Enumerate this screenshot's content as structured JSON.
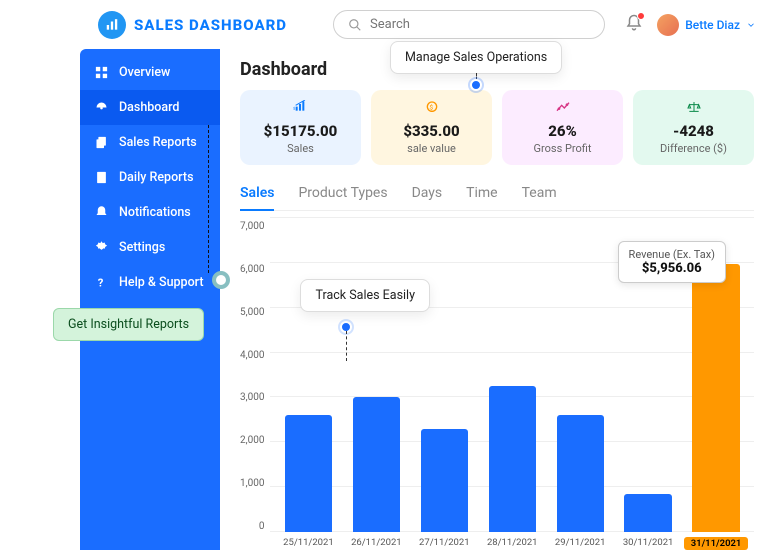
{
  "brand": "SALES  DASHBOARD",
  "search": {
    "placeholder": "Search"
  },
  "user": {
    "name": "Bette Diaz"
  },
  "sidebar": {
    "items": [
      {
        "label": "Overview"
      },
      {
        "label": "Dashboard"
      },
      {
        "label": "Sales Reports"
      },
      {
        "label": "Daily Reports"
      },
      {
        "label": "Notifications"
      },
      {
        "label": "Settings"
      },
      {
        "label": "Help & Support"
      }
    ]
  },
  "page_title": "Dashboard",
  "cards": [
    {
      "value": "$15175.00",
      "label": "Sales"
    },
    {
      "value": "$335.00",
      "label": "sale value"
    },
    {
      "value": "26%",
      "label": "Gross Profit"
    },
    {
      "value": "-4248",
      "label": "Difference ($)"
    }
  ],
  "tabs": [
    "Sales",
    "Product Types",
    "Days",
    "Time",
    "Team"
  ],
  "callouts": {
    "manage": "Manage Sales Operations",
    "track": "Track Sales Easily",
    "reports": "Get Insightful Reports",
    "tooltip_title": "Revenue (Ex. Tax)",
    "tooltip_value": "$5,956.06"
  },
  "chart_data": {
    "type": "bar",
    "title": "",
    "xlabel": "",
    "ylabel": "",
    "ylim": [
      0,
      7000
    ],
    "yticks": [
      "7,000",
      "6,000",
      "5,000",
      "4,000",
      "3,000",
      "2,000",
      "1,000",
      "0"
    ],
    "categories": [
      "25/11/2021",
      "26/11/2021",
      "27/11/2021",
      "28/11/2021",
      "29/11/2021",
      "30/11/2021",
      "31/11/2021"
    ],
    "values": [
      2600,
      3000,
      2300,
      3250,
      2600,
      850,
      5956
    ],
    "highlight_index": 6
  }
}
